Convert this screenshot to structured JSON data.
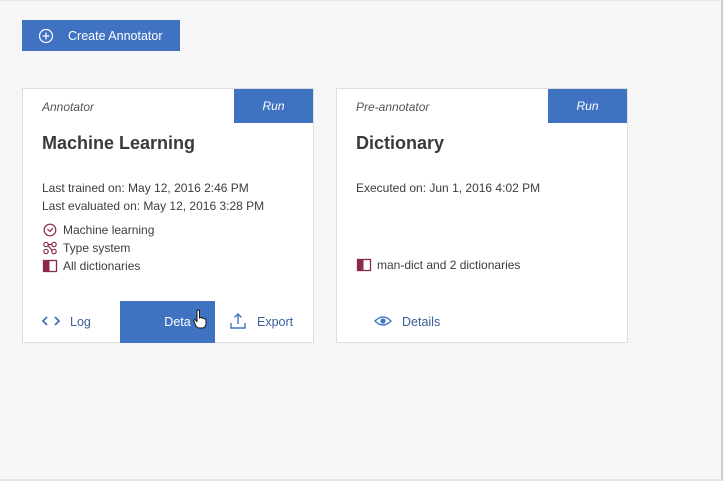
{
  "toolbar": {
    "create_label": "Create Annotator",
    "create_icon": "plus-circle-icon"
  },
  "cards": [
    {
      "kind": "Annotator",
      "run_label": "Run",
      "title": "Machine Learning",
      "meta": [
        "Last trained on: May 12, 2016 2:46 PM",
        "Last evaluated on: May 12, 2016 3:28 PM"
      ],
      "props": [
        {
          "icon": "clock-icon",
          "label": "Machine learning"
        },
        {
          "icon": "type-system-icon",
          "label": "Type system"
        },
        {
          "icon": "book-icon",
          "label": "All dictionaries"
        }
      ],
      "actions": [
        {
          "icon": "code-icon",
          "label": "Log"
        },
        {
          "icon": "none",
          "label": "Deta"
        },
        {
          "icon": "export-icon",
          "label": "Export"
        }
      ]
    },
    {
      "kind": "Pre-annotator",
      "run_label": "Run",
      "title": "Dictionary",
      "meta": [
        "Executed on: Jun 1, 2016 4:02 PM"
      ],
      "props": [
        {
          "icon": "book-icon",
          "label": "man-dict and 2 dictionaries"
        }
      ],
      "actions": [
        {
          "icon": "eye-icon",
          "label": "Details"
        }
      ]
    }
  ],
  "colors": {
    "accent": "#3f73c2",
    "icon_maroon": "#8a2a4a",
    "link": "#3a5f99"
  }
}
